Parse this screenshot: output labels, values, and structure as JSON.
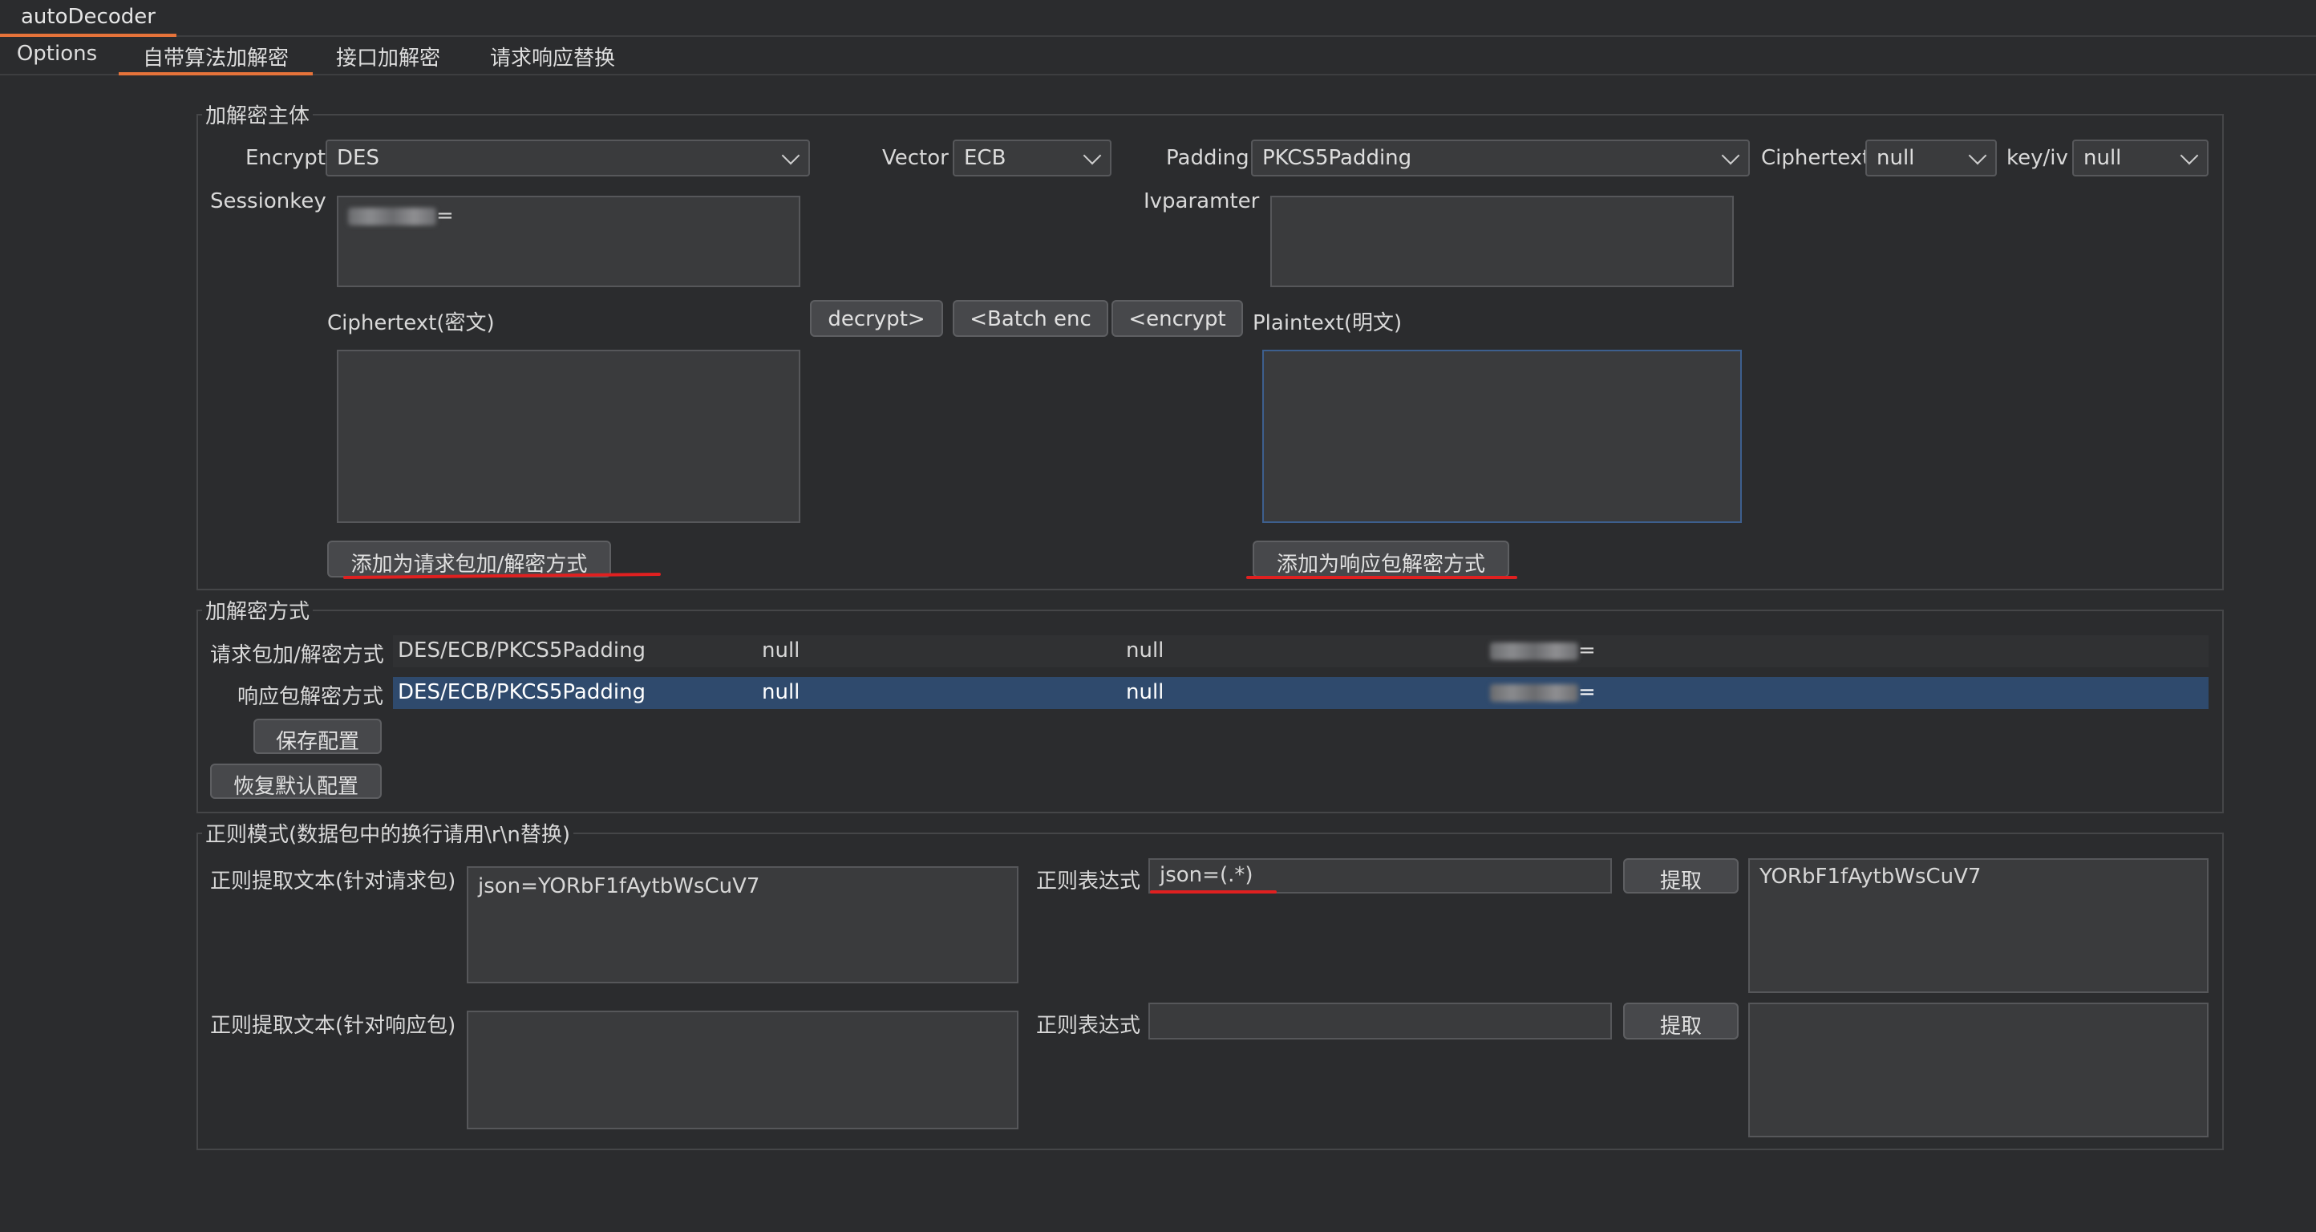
{
  "app": {
    "title": "autoDecoder"
  },
  "tabs": [
    {
      "label": "Options"
    },
    {
      "label": "自带算法加解密"
    },
    {
      "label": "接口加解密"
    },
    {
      "label": "请求响应替换"
    }
  ],
  "crypto_body": {
    "legend": "加解密主体",
    "encrypt_label": "Encrypt",
    "encrypt_value": "DES",
    "vector_label": "Vector",
    "vector_value": "ECB",
    "padding_label": "Padding",
    "padding_value": "PKCS5Padding",
    "ciphertext_label": "Ciphertext",
    "ciphertext_value": "null",
    "keyiv_label": "key/iv",
    "keyiv_value": "null",
    "sessionkey_label": "Sessionkey",
    "sessionkey_suffix": "=",
    "ivparam_label": "Ivparamter",
    "ciphertext_area_label": "Ciphertext(密文)",
    "plaintext_area_label": "Plaintext(明文)",
    "decrypt_button": "decrypt>",
    "batch_enc_button": "<Batch enc",
    "encrypt_button": "<encrypt",
    "add_request_button": "添加为请求包加/解密方式",
    "add_response_button": "添加为响应包解密方式"
  },
  "methods": {
    "legend": "加解密方式",
    "rows": [
      {
        "label": "请求包加/解密方式",
        "algo": "DES/ECB/PKCS5Padding",
        "c1": "null",
        "c2": "null",
        "key_suffix": "="
      },
      {
        "label": "响应包解密方式",
        "algo": "DES/ECB/PKCS5Padding",
        "c1": "null",
        "c2": "null",
        "key_suffix": "="
      }
    ],
    "save_button": "保存配置",
    "reset_button": "恢复默认配置"
  },
  "regex": {
    "legend": "正则模式(数据包中的换行请用\\r\\n替换)",
    "req_label": "正则提取文本(针对请求包)",
    "req_text": "json=YORbF1fAytbWsCuV7",
    "req_expr_label": "正则表达式",
    "req_expr_value": "json=(.*)",
    "req_extract_button": "提取",
    "req_result": "YORbF1fAytbWsCuV7",
    "resp_label": "正则提取文本(针对响应包)",
    "resp_text": "",
    "resp_expr_label": "正则表达式",
    "resp_expr_value": "",
    "resp_extract_button": "提取",
    "resp_result": ""
  },
  "colors": {
    "accent": "#e6733a",
    "selection": "#2f4a6d",
    "annotation": "#e02020"
  }
}
